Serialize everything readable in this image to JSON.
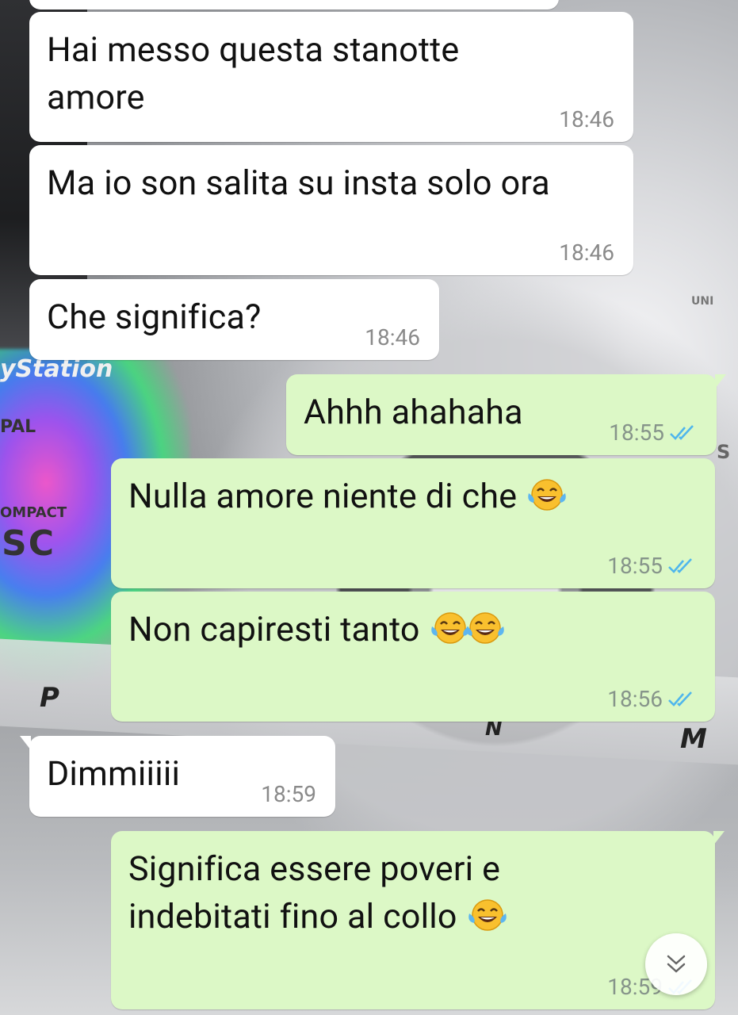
{
  "messages": [
    {
      "direction": "in",
      "text": "Hai messo questa stanotte amore",
      "time": "18:46"
    },
    {
      "direction": "in",
      "text": "Ma io son salita su insta solo ora",
      "time": "18:46"
    },
    {
      "direction": "in",
      "text": "Che significa?",
      "time": "18:46"
    },
    {
      "direction": "out",
      "text": "Ahhh ahahaha",
      "time": "18:55",
      "status": "read"
    },
    {
      "direction": "out",
      "text": "Nulla amore niente di che",
      "emoji_count": 1,
      "emoji": "face-with-tears-of-joy",
      "time": "18:55",
      "status": "read"
    },
    {
      "direction": "out",
      "text": "Non capiresti tanto",
      "emoji_count": 2,
      "emoji": "face-with-tears-of-joy",
      "time": "18:56",
      "status": "read"
    },
    {
      "direction": "in",
      "text": "Dimmiiiii",
      "time": "18:59"
    },
    {
      "direction": "out",
      "text": "Significa essere poveri e indebitati fino al collo",
      "emoji_count": 1,
      "emoji": "face-with-tears-of-joy",
      "time": "18:59",
      "status": "read"
    }
  ],
  "wallpaper": {
    "labels": [
      "yStation",
      "PAL",
      "OMPACT",
      "SC",
      "P",
      "N",
      "M",
      "UNI",
      "S"
    ]
  },
  "colors": {
    "incoming_bubble": "#ffffff",
    "outgoing_bubble": "#dcf8c6",
    "read_ticks": "#4fb6ec"
  },
  "scroll_button": {
    "icon": "chevron-double-down-icon"
  }
}
